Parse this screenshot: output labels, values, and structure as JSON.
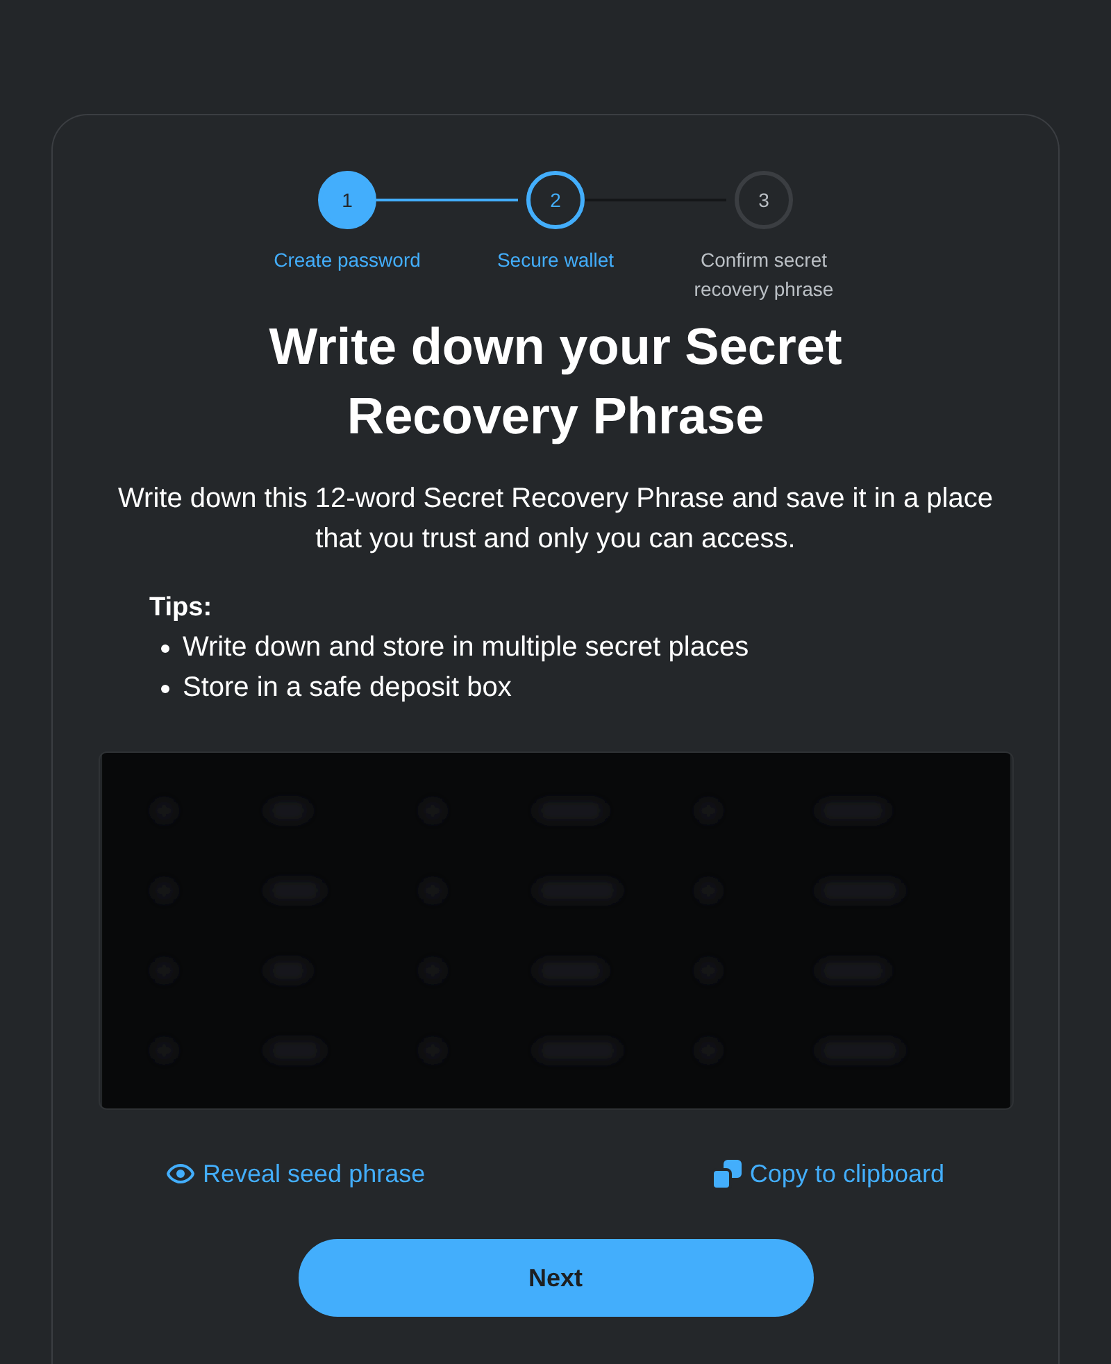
{
  "steps": [
    {
      "number": "1",
      "label": "Create password",
      "completed": true,
      "selected": false
    },
    {
      "number": "2",
      "label": "Secure wallet",
      "completed": false,
      "selected": true
    },
    {
      "number": "3",
      "label": "Confirm secret recovery phrase",
      "completed": false,
      "selected": false
    }
  ],
  "title": "Write down your Secret Recovery Phrase",
  "description": "Write down this 12-word Secret Recovery Phrase and save it in a place that you trust and only you can access.",
  "tips": {
    "heading": "Tips:",
    "items": [
      "Write down and store in multiple secret places",
      "Store in a safe deposit box"
    ]
  },
  "actions": [
    {
      "kind": "reveal",
      "label": "Reveal seed phrase"
    },
    {
      "kind": "copy",
      "label": "Copy to clipboard"
    }
  ],
  "next_button": "Next"
}
